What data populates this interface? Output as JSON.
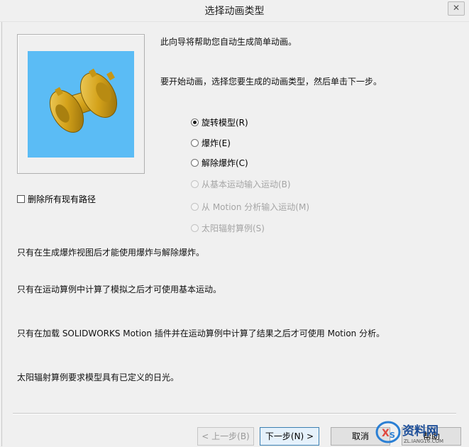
{
  "window": {
    "title": "选择动画类型",
    "close_label": "✕"
  },
  "intro": {
    "line1": "此向导将帮助您自动生成简单动画。",
    "line2": "要开始动画，选择您要生成的动画类型，然后单击下一步。"
  },
  "options": [
    {
      "label": "旋转模型(R)",
      "checked": true,
      "enabled": true
    },
    {
      "label": "爆炸(E)",
      "checked": false,
      "enabled": true
    },
    {
      "label": "解除爆炸(C)",
      "checked": false,
      "enabled": true
    },
    {
      "label": "从基本运动输入运动(B)",
      "checked": false,
      "enabled": false
    },
    {
      "label": "从 Motion 分析输入运动(M)",
      "checked": false,
      "enabled": false
    },
    {
      "label": "太阳辐射算例(S)",
      "checked": false,
      "enabled": false
    }
  ],
  "delete_paths": {
    "label": "删除所有现有路径",
    "checked": false
  },
  "notes": {
    "n1": "只有在生成爆炸视图后才能使用爆炸与解除爆炸。",
    "n2": "只有在运动算例中计算了模拟之后才可使用基本运动。",
    "n3": "只有在加载 SOLIDWORKS Motion 插件并在运动算例中计算了结果之后才可使用 Motion 分析。",
    "n4": "太阳辐射算例要求模型具有已定义的日光。"
  },
  "buttons": {
    "back": "< 上一步(B)",
    "next": "下一步(N) >",
    "cancel": "取消",
    "help": "帮助"
  },
  "watermark": {
    "text": "资料网",
    "sub": "ZL.IANG16.COM"
  },
  "colors": {
    "preview_bg": "#5bbcf5",
    "part": "#d4a21a"
  }
}
